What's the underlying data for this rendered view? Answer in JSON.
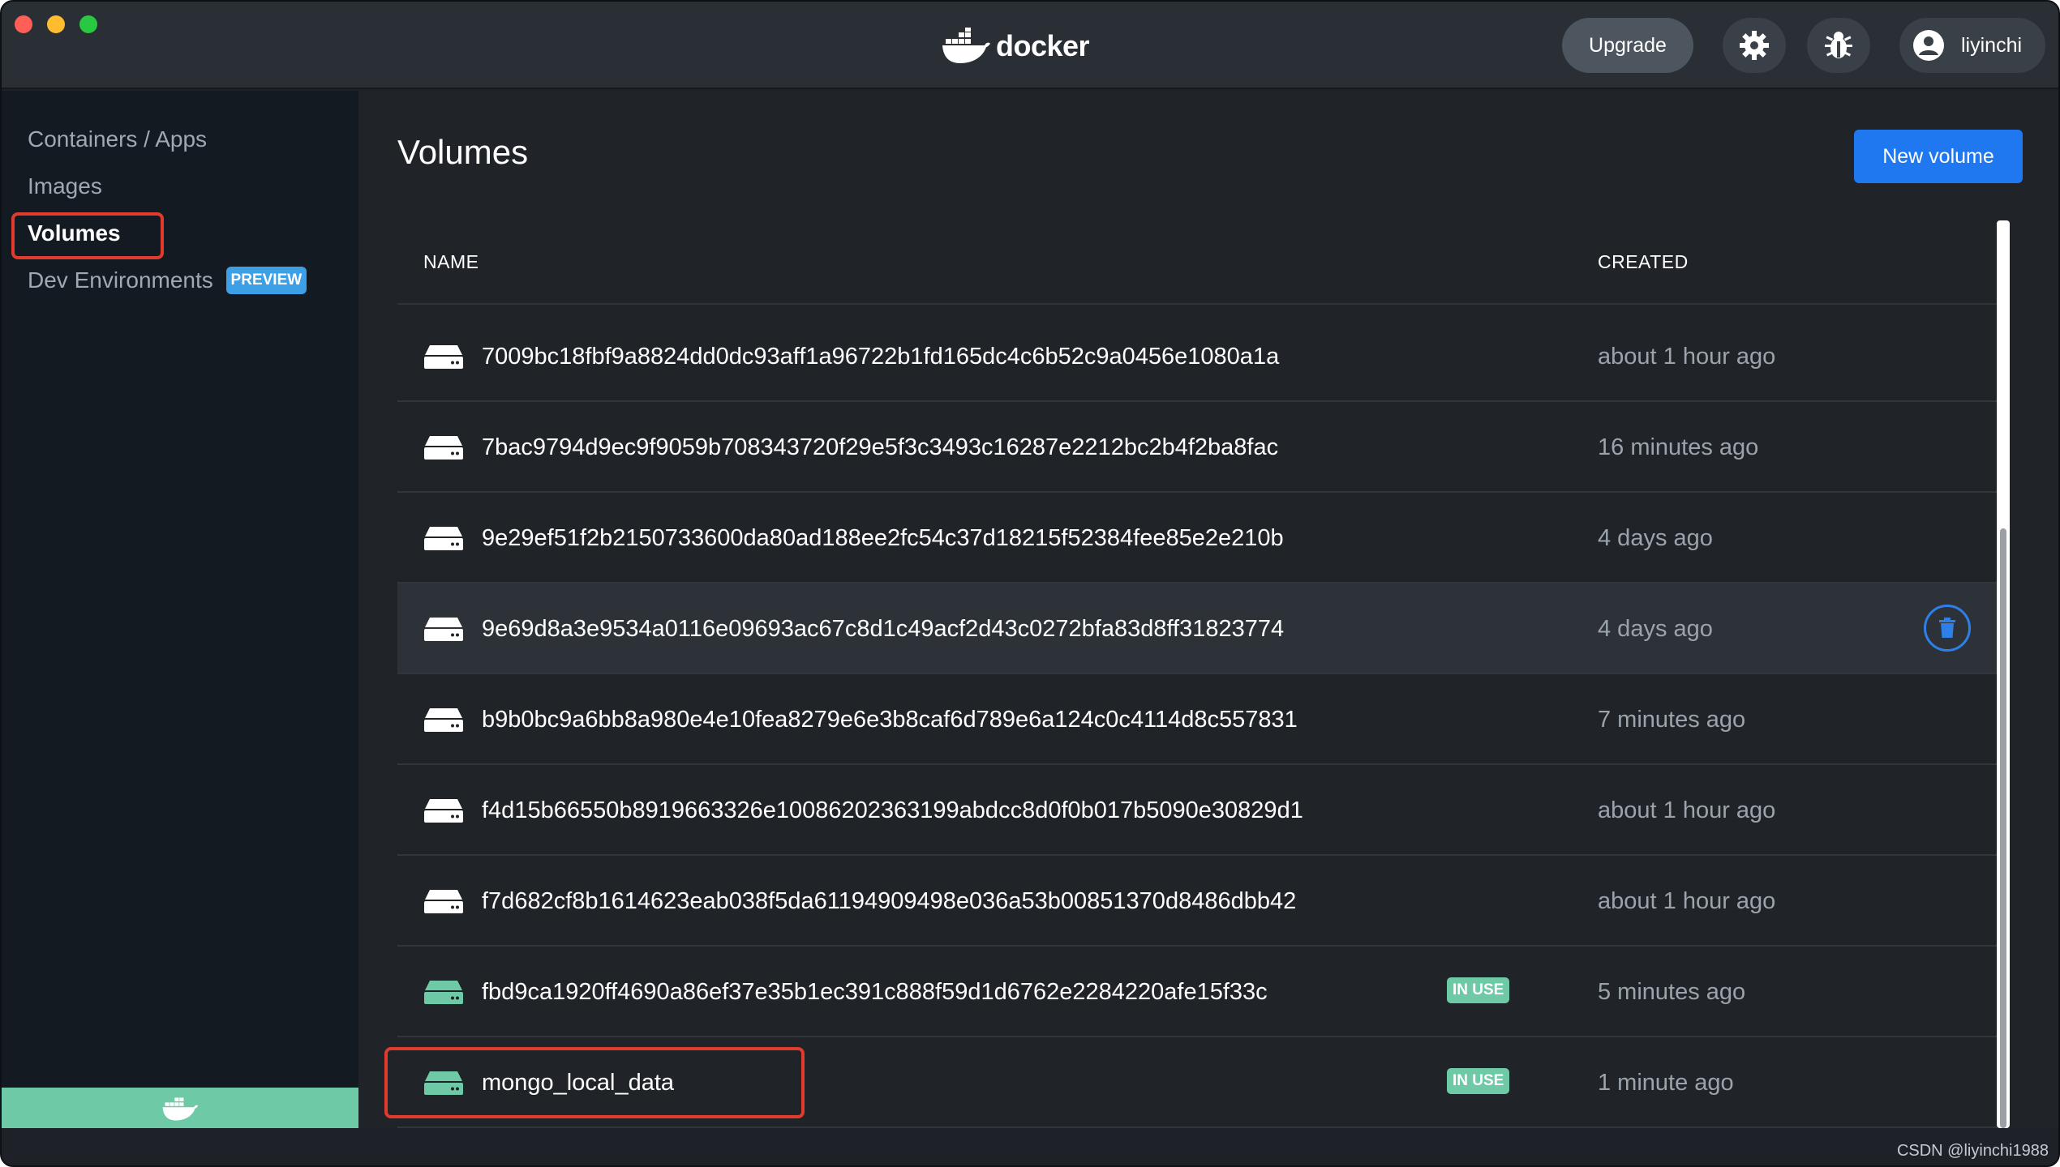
{
  "app": {
    "brand": "docker",
    "upgrade_label": "Upgrade",
    "user_name": "liyinchi"
  },
  "sidebar": {
    "items": [
      {
        "label": "Containers / Apps"
      },
      {
        "label": "Images"
      },
      {
        "label": "Volumes"
      },
      {
        "label": "Dev Environments",
        "badge": "PREVIEW"
      }
    ]
  },
  "main": {
    "title": "Volumes",
    "new_volume_label": "New volume",
    "columns": {
      "name": "NAME",
      "created": "CREATED"
    },
    "volumes": [
      {
        "name": "7009bc18fbf9a8824dd0dc93aff1a96722b1fd165dc4c6b52c9a0456e1080a1a",
        "created": "about 1 hour ago"
      },
      {
        "name": "7bac9794d9ec9f9059b708343720f29e5f3c3493c16287e2212bc2b4f2ba8fac",
        "created": "16 minutes ago"
      },
      {
        "name": "9e29ef51f2b2150733600da80ad188ee2fc54c37d18215f52384fee85e2e210b",
        "created": "4 days ago"
      },
      {
        "name": "9e69d8a3e9534a0116e09693ac67c8d1c49acf2d43c0272bfa83d8ff31823774",
        "created": "4 days ago"
      },
      {
        "name": "b9b0bc9a6bb8a980e4e10fea8279e6e3b8caf6d789e6a124c0c4114d8c557831",
        "created": "7 minutes ago"
      },
      {
        "name": "f4d15b66550b8919663326e10086202363199abdcc8d0f0b017b5090e30829d1",
        "created": "about 1 hour ago"
      },
      {
        "name": "f7d682cf8b1614623eab038f5da61194909498e036a53b00851370d8486dbb42",
        "created": "about 1 hour ago"
      },
      {
        "name": "fbd9ca1920ff4690a86ef37e35b1ec391c888f59d1d6762e2284220afe15f33c",
        "created": "5 minutes ago",
        "badge": "IN USE"
      },
      {
        "name": "mongo_local_data",
        "created": "1 minute ago",
        "badge": "IN USE"
      }
    ]
  },
  "watermark": "CSDN @liyinchi1988",
  "colors": {
    "accent": "#1f78f0",
    "in_use": "#6dc9a6",
    "highlight": "#e03b2c"
  }
}
